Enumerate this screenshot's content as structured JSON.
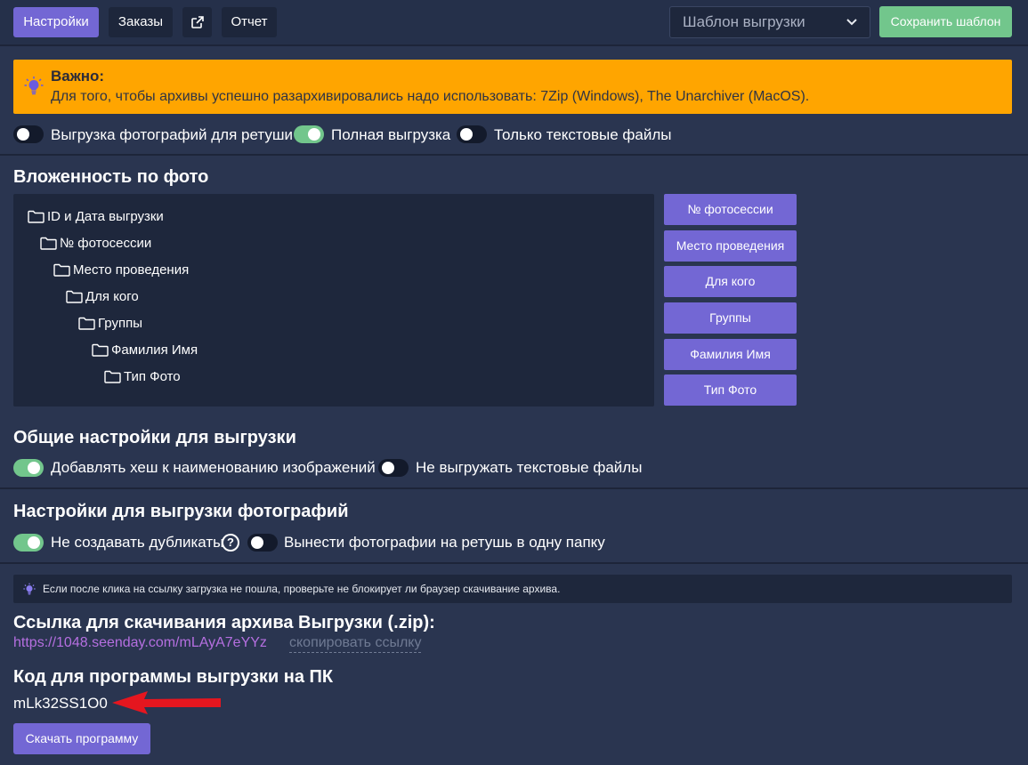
{
  "toolbar": {
    "settings_label": "Настройки",
    "orders_label": "Заказы",
    "external_icon": "external-link-icon",
    "report_label": "Отчет",
    "template_select": "Шаблон выгрузки",
    "save_template_label": "Сохранить шаблон"
  },
  "warning": {
    "icon": "lightbulb-icon",
    "title": "Важно:",
    "text": "Для того, чтобы архивы успешно разархивировались надо использовать: 7Zip (Windows), The Unarchiver (MacOS)."
  },
  "export_modes": [
    {
      "label": "Выгрузка фотографий для ретуши",
      "on": false
    },
    {
      "label": "Полная выгрузка",
      "on": true
    },
    {
      "label": "Только текстовые файлы",
      "on": false
    }
  ],
  "nesting": {
    "title": "Вложенность по фото",
    "tree": [
      "ID и Дата выгрузки",
      "№ фотосессии",
      "Место проведения",
      "Для кого",
      "Группы",
      "Фамилия Имя",
      "Тип Фото"
    ],
    "buttons": [
      "№ фотосессии",
      "Место проведения",
      "Для кого",
      "Группы",
      "Фамилия Имя",
      "Тип Фото"
    ]
  },
  "general": {
    "title": "Общие настройки для выгрузки",
    "toggles": [
      {
        "label": "Добавлять хеш к наименованию изображений",
        "on": true
      },
      {
        "label": "Не выгружать текстовые файлы",
        "on": false
      }
    ]
  },
  "photo_settings": {
    "title": "Настройки для выгрузки фотографий",
    "toggles": [
      {
        "label": "Не создавать дубликаты",
        "on": true
      },
      {
        "label": "Вынести фотографии на ретушь в одну папку",
        "on": false
      }
    ],
    "help": "?"
  },
  "info": {
    "icon": "lightbulb-icon",
    "text": "Если после клика на ссылку загрузка не пошла, проверьте не блокирует ли браузер скачивание архива."
  },
  "download": {
    "title": "Ссылка для скачивания архива Выгрузки (.zip):",
    "url": "https://1048.seenday.com/mLAyA7eYYz",
    "copy_label": "скопировать ссылку"
  },
  "program": {
    "title": "Код для программы выгрузки на ПК",
    "code": "mLk32SS1O0",
    "download_button": "Скачать программу"
  },
  "colors": {
    "background": "#2a3550",
    "panel": "#1e273c",
    "accent_purple": "#7367d4",
    "accent_green": "#72c68c",
    "warning": "#ffa500",
    "link": "#b56fe0",
    "annotation_arrow": "#e5161f"
  }
}
